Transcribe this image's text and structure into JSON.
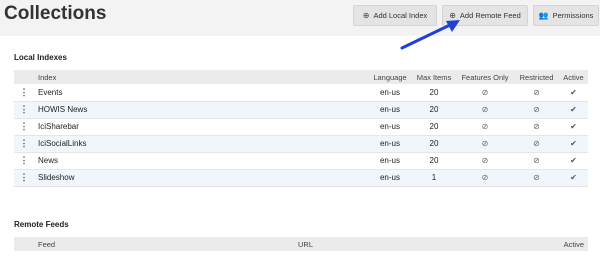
{
  "header": {
    "title": "Collections",
    "buttons": {
      "add_local_index": {
        "label": "Add Local Index",
        "icon": "plus-circle-icon"
      },
      "add_remote_feed": {
        "label": "Add Remote Feed",
        "icon": "plus-circle-icon"
      },
      "permissions": {
        "label": "Permissions",
        "icon": "users-icon"
      }
    }
  },
  "annotation": {
    "arrow_color": "#1f3fd6"
  },
  "local_indexes": {
    "title": "Local Indexes",
    "columns": [
      "Index",
      "Language",
      "Max Items",
      "Features Only",
      "Restricted",
      "Active"
    ],
    "rows": [
      {
        "name": "Events",
        "language": "en-us",
        "max_items": "20",
        "features_only": "⊘",
        "restricted": "⊘",
        "active": "✔"
      },
      {
        "name": "HOWIS News",
        "language": "en-us",
        "max_items": "20",
        "features_only": "⊘",
        "restricted": "⊘",
        "active": "✔"
      },
      {
        "name": "IciSharebar",
        "language": "en-us",
        "max_items": "20",
        "features_only": "⊘",
        "restricted": "⊘",
        "active": "✔"
      },
      {
        "name": "IciSocialLinks",
        "language": "en-us",
        "max_items": "20",
        "features_only": "⊘",
        "restricted": "⊘",
        "active": "✔"
      },
      {
        "name": "News",
        "language": "en-us",
        "max_items": "20",
        "features_only": "⊘",
        "restricted": "⊘",
        "active": "✔"
      },
      {
        "name": "Slideshow",
        "language": "en-us",
        "max_items": "1",
        "features_only": "⊘",
        "restricted": "⊘",
        "active": "✔"
      }
    ]
  },
  "remote_feeds": {
    "title": "Remote Feeds",
    "columns": [
      "Feed",
      "URL",
      "Active"
    ]
  }
}
